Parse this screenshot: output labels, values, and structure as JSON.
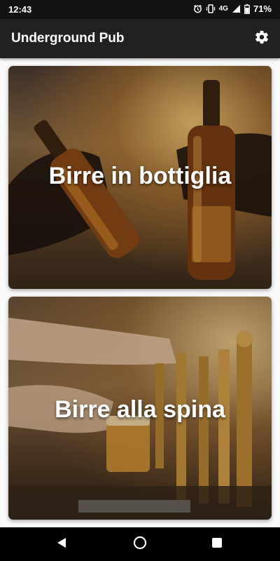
{
  "status_bar": {
    "time": "12:43",
    "network": "4G",
    "battery": "71%"
  },
  "app_bar": {
    "title": "Underground Pub",
    "settings_icon": "gear-icon"
  },
  "cards": [
    {
      "label": "Birre in bottiglia",
      "image": "beer-bottles-toast-photo"
    },
    {
      "label": "Birre alla spina",
      "image": "beer-tap-pouring-photo"
    }
  ],
  "nav_bar": {
    "back_icon": "back-triangle-icon",
    "home_icon": "home-circle-icon",
    "recents_icon": "recents-square-icon"
  },
  "colors": {
    "status_bar": "#121212",
    "app_bar": "#212121",
    "background": "#fafafa",
    "nav_bar": "#000000"
  }
}
